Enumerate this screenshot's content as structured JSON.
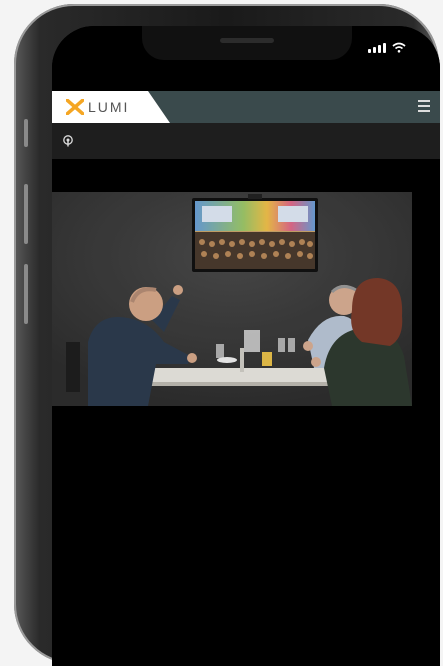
{
  "app": {
    "logo_text": "LUMI",
    "logo_mark": "x-logo-icon"
  },
  "status": {
    "signal_icon": "cellular-signal-icon",
    "wifi_icon": "wifi-icon"
  },
  "header": {
    "menu_icon": "hamburger-menu-icon",
    "background": "#3a4a4c"
  },
  "toolbar": {
    "broadcast_icon": "broadcast-icon"
  },
  "video": {
    "description_icon": "video-player"
  },
  "colors": {
    "accent_orange": "#f5a623",
    "header": "#3a4a4c",
    "toolbar": "#1e1e1e",
    "screen_bg": "#000000"
  }
}
